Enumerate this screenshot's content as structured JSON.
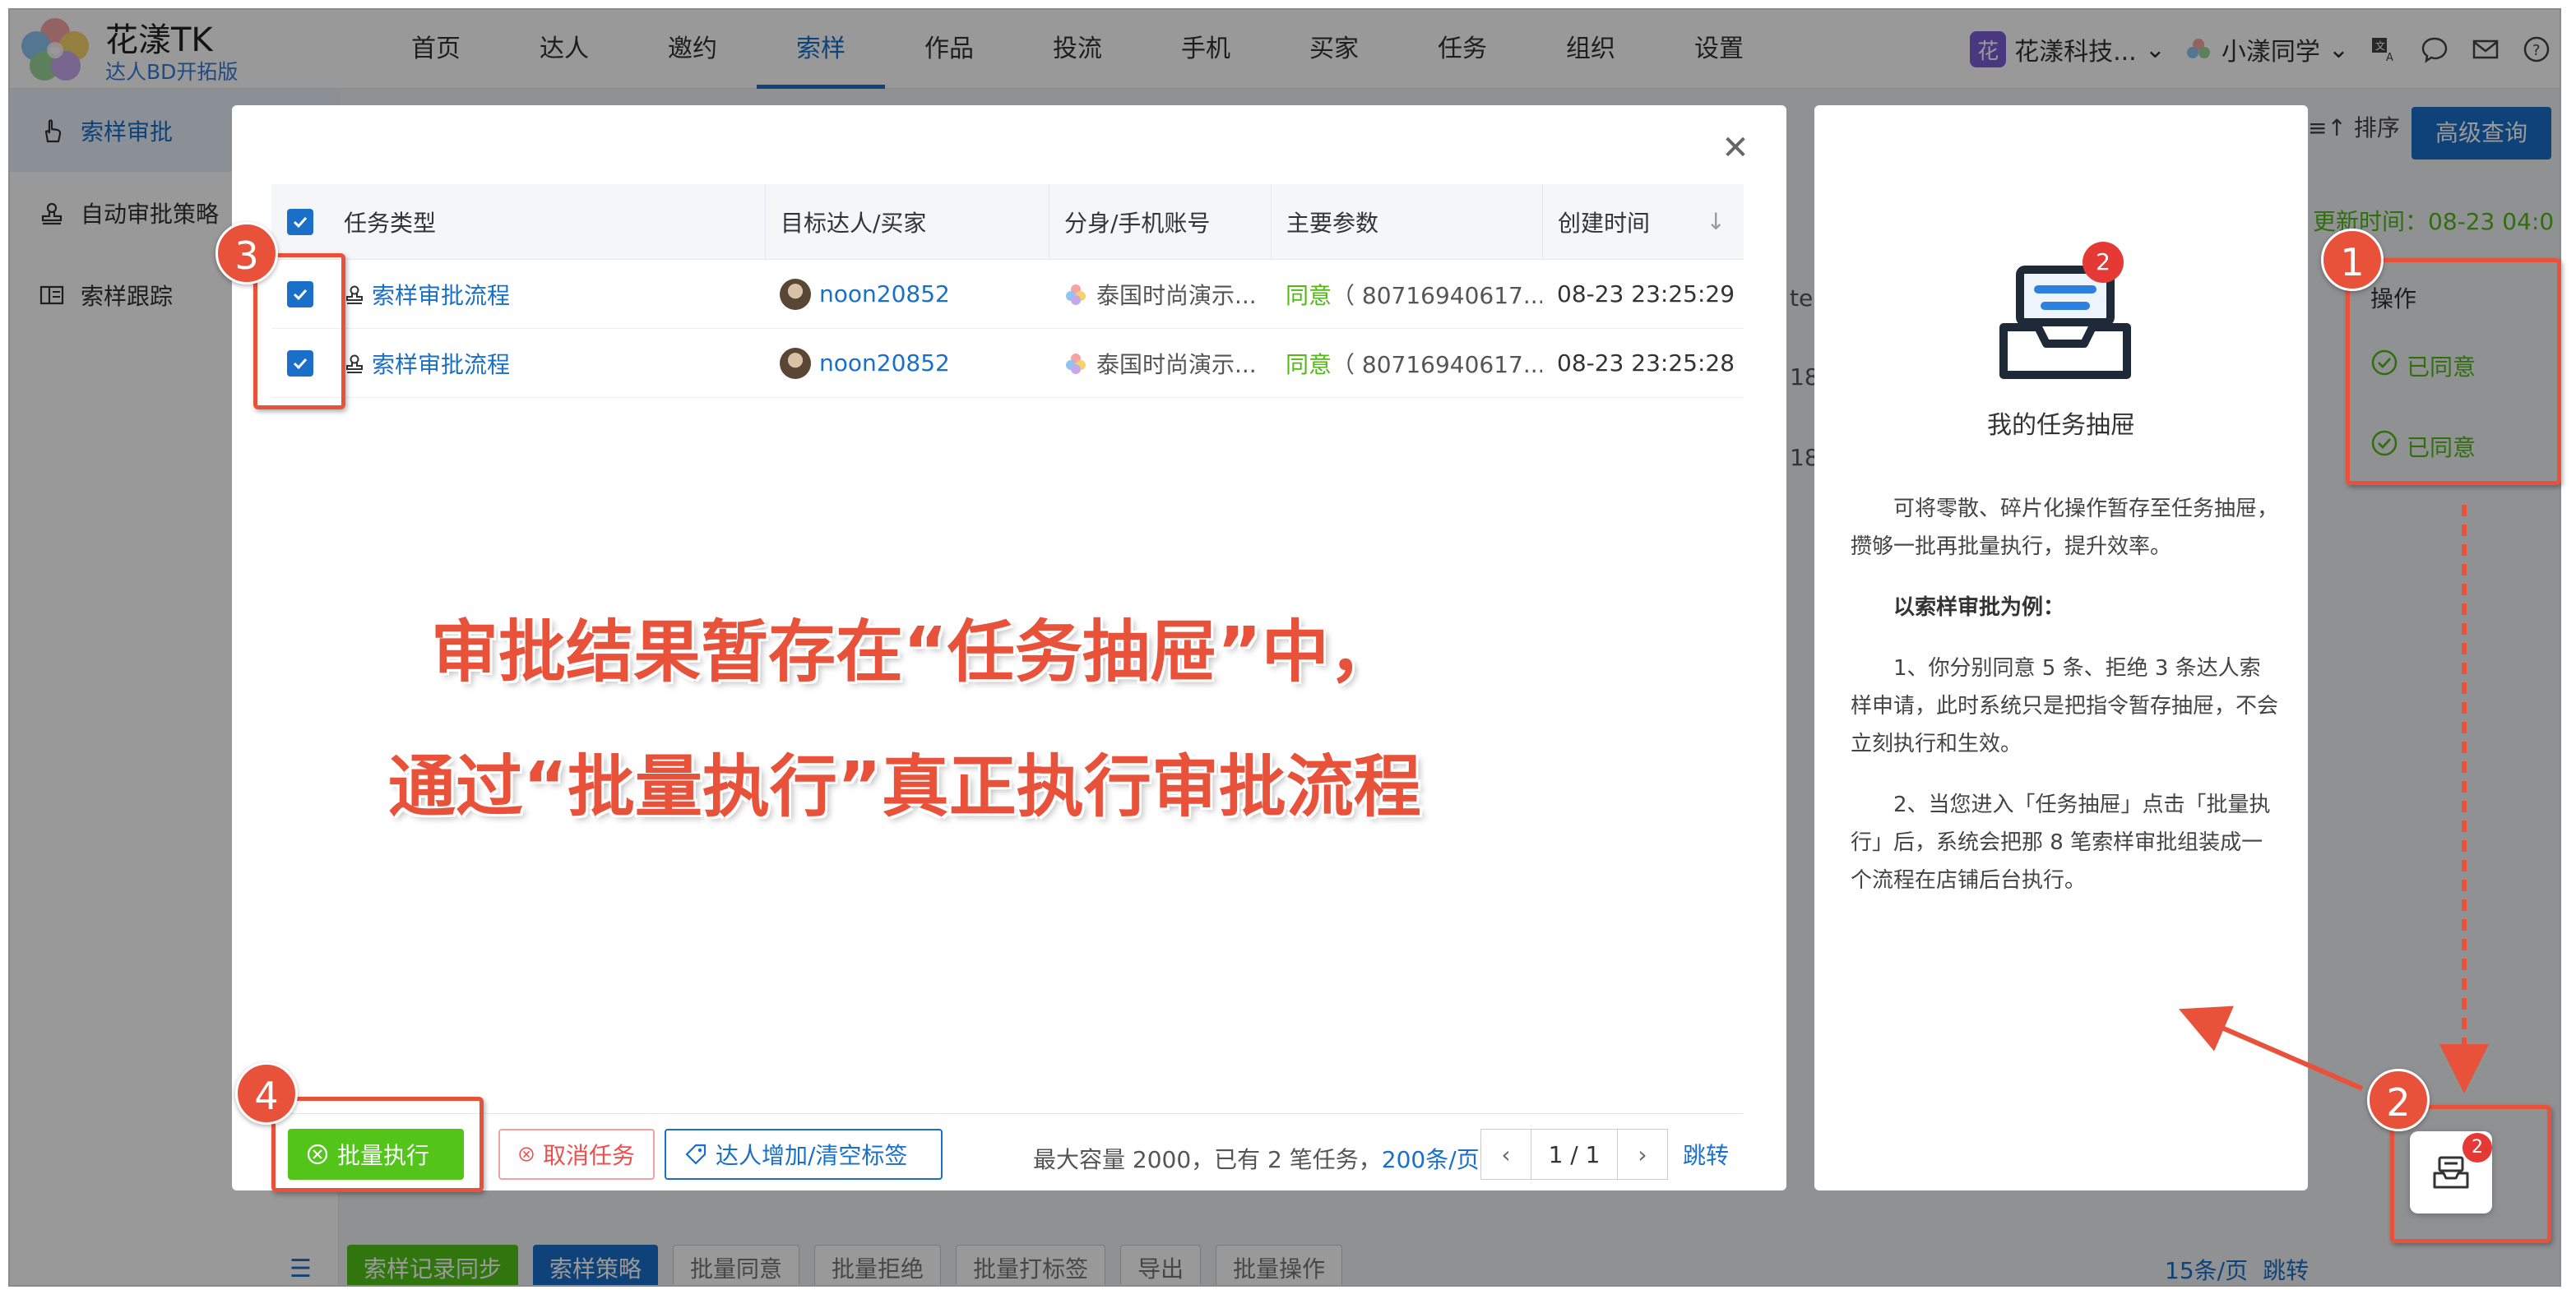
{
  "app": {
    "brand_name": "花漾TK",
    "brand_sub": "达人BD开拓版",
    "nav": [
      "首页",
      "达人",
      "邀约",
      "索样",
      "作品",
      "投流",
      "手机",
      "买家",
      "任务",
      "组织",
      "设置"
    ],
    "active_nav": "索样",
    "org_badge": "花",
    "org_name": "花漾科技...",
    "user_name": "小漾同学"
  },
  "sidebar": {
    "items": [
      {
        "label": "索样审批",
        "icon": "pointer-hand-icon",
        "active": true
      },
      {
        "label": "自动审批策略",
        "icon": "stamp-icon",
        "active": false
      },
      {
        "label": "索样跟踪",
        "icon": "track-card-icon",
        "active": false
      }
    ]
  },
  "background": {
    "sort_label": "排序",
    "adv_query": "高级查询",
    "update_time": "更新时间：08-23 04:0",
    "col_action": "操作",
    "approved_label": "已同意",
    "cut_col": "te",
    "cut_num": "18",
    "bottom_buttons": [
      "索样记录同步",
      "索样策略",
      "批量同意",
      "批量拒绝",
      "批量打标签",
      "导出",
      "批量操作"
    ],
    "page_size": "15条/页",
    "jump": "跳转"
  },
  "modal": {
    "columns": [
      "任务类型",
      "目标达人/买家",
      "分身/手机账号",
      "主要参数",
      "创建时间"
    ],
    "rows": [
      {
        "task_type": "索样审批流程",
        "target": "noon20852",
        "account": "泰国时尚演示...",
        "param_status": "同意",
        "param_value": "（ 80716940617...",
        "created": "08-23 23:25:29"
      },
      {
        "task_type": "索样审批流程",
        "target": "noon20852",
        "account": "泰国时尚演示...",
        "param_status": "同意",
        "param_value": "（ 80716940617...",
        "created": "08-23 23:25:28"
      }
    ],
    "footer": {
      "exec_label": "批量执行",
      "cancel_label": "取消任务",
      "tag_label": "达人增加/清空标签",
      "capacity_text": "最大容量 2000，已有 2 笔任务，",
      "page_size": "200条/页",
      "page": "1 / 1",
      "jump": "跳转"
    }
  },
  "drawer": {
    "badge": "2",
    "title": "我的任务抽屉",
    "para1": "可将零散、碎片化操作暂存至任务抽屉，攒够一批再批量执行，提升效率。",
    "para2": "以索样审批为例：",
    "para3": "1、你分别同意 5 条、拒绝 3 条达人索样申请，此时系统只是把指令暂存抽屉，不会立刻执行和生效。",
    "para4": "2、当您进入「任务抽屉」点击「批量执行」后，系统会把那 8 笔索样审批组装成一个流程在店铺后台执行。"
  },
  "annotations": {
    "line1": "审批结果暂存在“任务抽屉”中，",
    "line2": "通过“批量执行”真正执行审批流程",
    "callouts": [
      "1",
      "2",
      "3",
      "4"
    ],
    "fab_badge": "2"
  },
  "colors": {
    "accent_blue": "#1a6fc9",
    "success_green": "#52c41a",
    "annotation_red": "#e8523b",
    "badge_red": "#e53935"
  }
}
